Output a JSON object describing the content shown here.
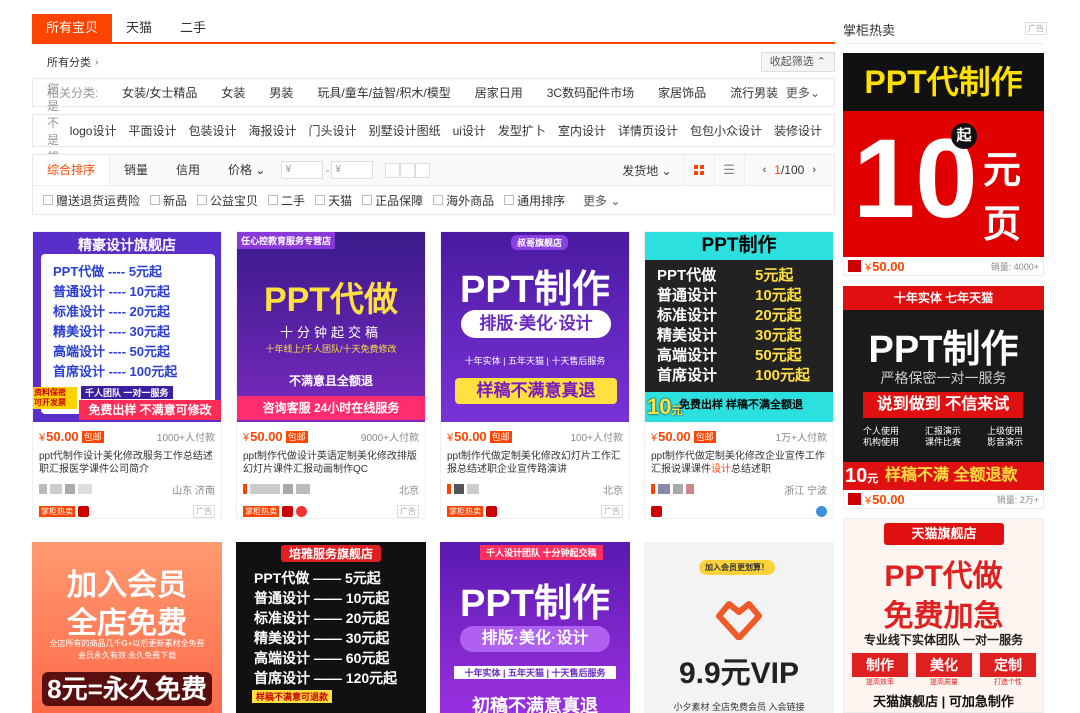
{
  "tabs": [
    "所有宝贝",
    "天猫",
    "二手"
  ],
  "category": {
    "label": "所有分类",
    "collapse": "收起筛选"
  },
  "related": {
    "label": "相关分类:",
    "items": [
      "女装/女士精品",
      "女装",
      "男装",
      "玩具/童车/益智/积木/模型",
      "居家日用",
      "3C数码配件市场",
      "家居饰品",
      "流行男装"
    ],
    "more": "更多"
  },
  "suggest": {
    "label": "您是不是想找:",
    "items": [
      "logo设计",
      "平面设计",
      "包装设计",
      "海报设计",
      "门头设计",
      "别墅设计图纸",
      "ui设计",
      "发型扩卜",
      "室内设计",
      "详情页设计",
      "包包小众设计",
      "装修设计"
    ]
  },
  "sort": {
    "items": [
      "综合排序",
      "销量",
      "信用",
      "价格"
    ],
    "price_min_ph": "¥",
    "price_max_ph": "¥",
    "ship_from": "发货地",
    "page_current": "1",
    "page_total": "/100"
  },
  "checks": [
    "赠送退货运费险",
    "新品",
    "公益宝贝",
    "二手",
    "天猫",
    "正品保障",
    "海外商品",
    "通用排序"
  ],
  "checks_more": "更多",
  "products": [
    {
      "currency": "¥",
      "price": "50.00",
      "baoyou": "包邮",
      "sales": "1000+人付款",
      "title": "ppt代制作设计美化修改服务工作总结述职汇报医学课件公司简介",
      "location": "山东 济南",
      "zg": "掌柜热卖",
      "img": {
        "header": "精豪设计旗舰店",
        "rows": [
          "PPT代做 ---- 5元起",
          "普通设计 ---- 10元起",
          "标准设计 ---- 20元起",
          "精美设计 ---- 30元起",
          "高端设计 ---- 50元起",
          "首席设计 ---- 100元起"
        ],
        "corner": "资料保密 可开发票",
        "team": "千人团队 一对一服务",
        "bottom": "免费出样 不满意可修改"
      }
    },
    {
      "currency": "¥",
      "price": "50.00",
      "baoyou": "包邮",
      "sales": "9000+人付款",
      "title": "ppt制作代做设计英语定制美化修改排版幻灯片课件汇报动画制作QC",
      "location": "北京",
      "zg": "掌柜热卖",
      "img": {
        "header": "任心控教育服务专营店",
        "big": "PPT代做",
        "sub": "十分钟起交稿",
        "line": "十年线上/千人团队/十天免费修改",
        "mid": "不满意且全额退",
        "bottom": "咨询客服  24小时在线服务"
      }
    },
    {
      "currency": "¥",
      "price": "50.00",
      "baoyou": "包邮",
      "sales": "100+人付款",
      "title": "ppt制作代做定制美化修改幻灯片工作汇报总结述职企业宣传路演讲",
      "location": "北京",
      "zg": "掌柜热卖",
      "img": {
        "header": "叔哥旗舰店",
        "big": "PPT制作",
        "ribbon": "排版·美化·设计",
        "line": "十年实体 | 五年天猫 | 十天售后服务",
        "bottom": "样稿不满意真退"
      }
    },
    {
      "currency": "¥",
      "price": "50.00",
      "baoyou": "包邮",
      "sales": "1万+人付款",
      "title": "ppt制作代做定制美化修改企业宣传工作汇报说课课件设计总结述职",
      "title_hl": "设计",
      "location": "浙江 宁波",
      "img": {
        "header": "PPT制作",
        "rows": [
          [
            "PPT代做",
            "5元起"
          ],
          [
            "普通设计",
            "10元起"
          ],
          [
            "标准设计",
            "20元起"
          ],
          [
            "精美设计",
            "30元起"
          ],
          [
            "高端设计",
            "50元起"
          ],
          [
            "首席设计",
            "100元起"
          ]
        ],
        "bottom_num": "10",
        "bottom_unit": "元",
        "bottom": "免费出样 样稿不满全额退"
      }
    }
  ],
  "row2": [
    {
      "l1": "加入会员",
      "l2": "全店免费",
      "small": "全店所有的商品几千G+以后更新素材全免费",
      "small2": "会员永久有效  永久免费下载",
      "bottom": "8元=永久免费"
    },
    {
      "header": "培雅服务旗舰店",
      "rows": [
        "PPT代做 —— 5元起",
        "普通设计 —— 10元起",
        "标准设计 —— 20元起",
        "精美设计 —— 30元起",
        "高端设计 —— 60元起",
        "首席设计 —— 120元起"
      ],
      "bottom": "样稿不满意可退款"
    },
    {
      "header": "千人设计团队 十分钟起交稿",
      "big": "PPT制作",
      "ribbon": "排版·美化·设计",
      "line": "十年实体 | 五年天猫 | 十天售后服务",
      "bottom": "初稿不满意真退"
    },
    {
      "pill": "加入会员更划算！",
      "big": "9.9元VIP",
      "small": "小夕素材 全店免费会员 入会链接"
    }
  ],
  "side": {
    "title": "掌柜热卖",
    "ad": "广告",
    "cards": [
      {
        "top": "PPT代制作",
        "qi": "起",
        "num": "10",
        "unit1": "元",
        "unit2": "页",
        "currency": "¥",
        "price": "50.00",
        "sales": "销量: 4000+"
      },
      {
        "header": "十年实体 七年天猫",
        "big": "PPT制作",
        "sub": "严格保密一对一服务",
        "banner": "说到做到 不信来试",
        "list": [
          "个人使用",
          "汇报演示",
          "上级使用",
          "机构使用",
          "课件比赛",
          "影音演示"
        ],
        "bottom_num": "10",
        "bottom_unit": "元",
        "bottom": "样稿不满 全额退款",
        "currency": "¥",
        "price": "50.00",
        "sales": "销量: 2万+"
      },
      {
        "header": "天猫旗舰店",
        "big1": "PPT代做",
        "big2": "免费加急",
        "line": "专业线下实体团队 一对一服务",
        "buttons": [
          "制作",
          "美化",
          "定制"
        ],
        "btn_sub": [
          "提高效率",
          "提高质量",
          "打造个性"
        ],
        "bottom": "天猫旗舰店 | 可加急制作"
      }
    ]
  },
  "ad_label": "广告",
  "colors": {
    "accent": "#ff4400",
    "price": "#ff4400"
  }
}
